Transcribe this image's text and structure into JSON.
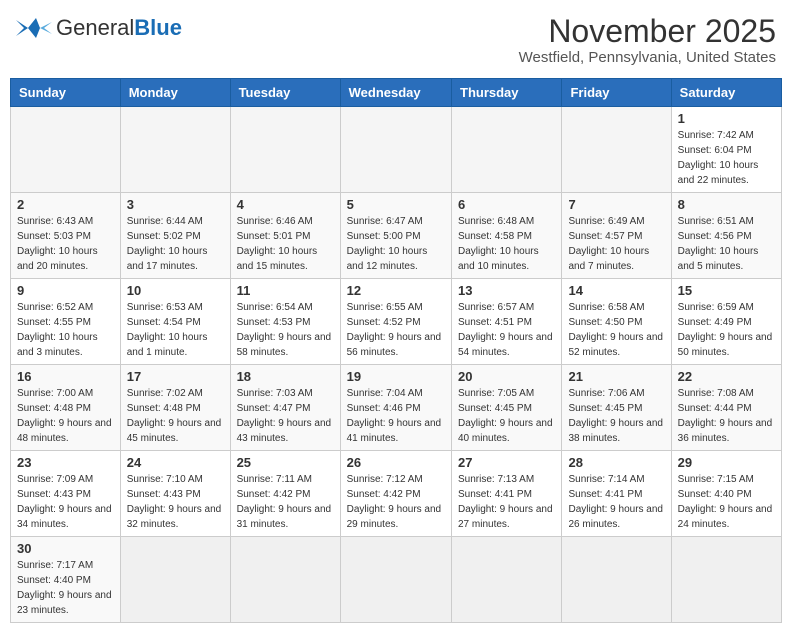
{
  "logo": {
    "text_general": "General",
    "text_blue": "Blue"
  },
  "title": "November 2025",
  "location": "Westfield, Pennsylvania, United States",
  "days_of_week": [
    "Sunday",
    "Monday",
    "Tuesday",
    "Wednesday",
    "Thursday",
    "Friday",
    "Saturday"
  ],
  "weeks": [
    [
      {
        "day": "",
        "info": ""
      },
      {
        "day": "",
        "info": ""
      },
      {
        "day": "",
        "info": ""
      },
      {
        "day": "",
        "info": ""
      },
      {
        "day": "",
        "info": ""
      },
      {
        "day": "",
        "info": ""
      },
      {
        "day": "1",
        "info": "Sunrise: 7:42 AM\nSunset: 6:04 PM\nDaylight: 10 hours and 22 minutes."
      }
    ],
    [
      {
        "day": "2",
        "info": "Sunrise: 6:43 AM\nSunset: 5:03 PM\nDaylight: 10 hours and 20 minutes."
      },
      {
        "day": "3",
        "info": "Sunrise: 6:44 AM\nSunset: 5:02 PM\nDaylight: 10 hours and 17 minutes."
      },
      {
        "day": "4",
        "info": "Sunrise: 6:46 AM\nSunset: 5:01 PM\nDaylight: 10 hours and 15 minutes."
      },
      {
        "day": "5",
        "info": "Sunrise: 6:47 AM\nSunset: 5:00 PM\nDaylight: 10 hours and 12 minutes."
      },
      {
        "day": "6",
        "info": "Sunrise: 6:48 AM\nSunset: 4:58 PM\nDaylight: 10 hours and 10 minutes."
      },
      {
        "day": "7",
        "info": "Sunrise: 6:49 AM\nSunset: 4:57 PM\nDaylight: 10 hours and 7 minutes."
      },
      {
        "day": "8",
        "info": "Sunrise: 6:51 AM\nSunset: 4:56 PM\nDaylight: 10 hours and 5 minutes."
      }
    ],
    [
      {
        "day": "9",
        "info": "Sunrise: 6:52 AM\nSunset: 4:55 PM\nDaylight: 10 hours and 3 minutes."
      },
      {
        "day": "10",
        "info": "Sunrise: 6:53 AM\nSunset: 4:54 PM\nDaylight: 10 hours and 1 minute."
      },
      {
        "day": "11",
        "info": "Sunrise: 6:54 AM\nSunset: 4:53 PM\nDaylight: 9 hours and 58 minutes."
      },
      {
        "day": "12",
        "info": "Sunrise: 6:55 AM\nSunset: 4:52 PM\nDaylight: 9 hours and 56 minutes."
      },
      {
        "day": "13",
        "info": "Sunrise: 6:57 AM\nSunset: 4:51 PM\nDaylight: 9 hours and 54 minutes."
      },
      {
        "day": "14",
        "info": "Sunrise: 6:58 AM\nSunset: 4:50 PM\nDaylight: 9 hours and 52 minutes."
      },
      {
        "day": "15",
        "info": "Sunrise: 6:59 AM\nSunset: 4:49 PM\nDaylight: 9 hours and 50 minutes."
      }
    ],
    [
      {
        "day": "16",
        "info": "Sunrise: 7:00 AM\nSunset: 4:48 PM\nDaylight: 9 hours and 48 minutes."
      },
      {
        "day": "17",
        "info": "Sunrise: 7:02 AM\nSunset: 4:48 PM\nDaylight: 9 hours and 45 minutes."
      },
      {
        "day": "18",
        "info": "Sunrise: 7:03 AM\nSunset: 4:47 PM\nDaylight: 9 hours and 43 minutes."
      },
      {
        "day": "19",
        "info": "Sunrise: 7:04 AM\nSunset: 4:46 PM\nDaylight: 9 hours and 41 minutes."
      },
      {
        "day": "20",
        "info": "Sunrise: 7:05 AM\nSunset: 4:45 PM\nDaylight: 9 hours and 40 minutes."
      },
      {
        "day": "21",
        "info": "Sunrise: 7:06 AM\nSunset: 4:45 PM\nDaylight: 9 hours and 38 minutes."
      },
      {
        "day": "22",
        "info": "Sunrise: 7:08 AM\nSunset: 4:44 PM\nDaylight: 9 hours and 36 minutes."
      }
    ],
    [
      {
        "day": "23",
        "info": "Sunrise: 7:09 AM\nSunset: 4:43 PM\nDaylight: 9 hours and 34 minutes."
      },
      {
        "day": "24",
        "info": "Sunrise: 7:10 AM\nSunset: 4:43 PM\nDaylight: 9 hours and 32 minutes."
      },
      {
        "day": "25",
        "info": "Sunrise: 7:11 AM\nSunset: 4:42 PM\nDaylight: 9 hours and 31 minutes."
      },
      {
        "day": "26",
        "info": "Sunrise: 7:12 AM\nSunset: 4:42 PM\nDaylight: 9 hours and 29 minutes."
      },
      {
        "day": "27",
        "info": "Sunrise: 7:13 AM\nSunset: 4:41 PM\nDaylight: 9 hours and 27 minutes."
      },
      {
        "day": "28",
        "info": "Sunrise: 7:14 AM\nSunset: 4:41 PM\nDaylight: 9 hours and 26 minutes."
      },
      {
        "day": "29",
        "info": "Sunrise: 7:15 AM\nSunset: 4:40 PM\nDaylight: 9 hours and 24 minutes."
      }
    ],
    [
      {
        "day": "30",
        "info": "Sunrise: 7:17 AM\nSunset: 4:40 PM\nDaylight: 9 hours and 23 minutes."
      },
      {
        "day": "",
        "info": ""
      },
      {
        "day": "",
        "info": ""
      },
      {
        "day": "",
        "info": ""
      },
      {
        "day": "",
        "info": ""
      },
      {
        "day": "",
        "info": ""
      },
      {
        "day": "",
        "info": ""
      }
    ]
  ],
  "colors": {
    "header_bg": "#2a6ebb",
    "accent": "#1a6db5"
  }
}
